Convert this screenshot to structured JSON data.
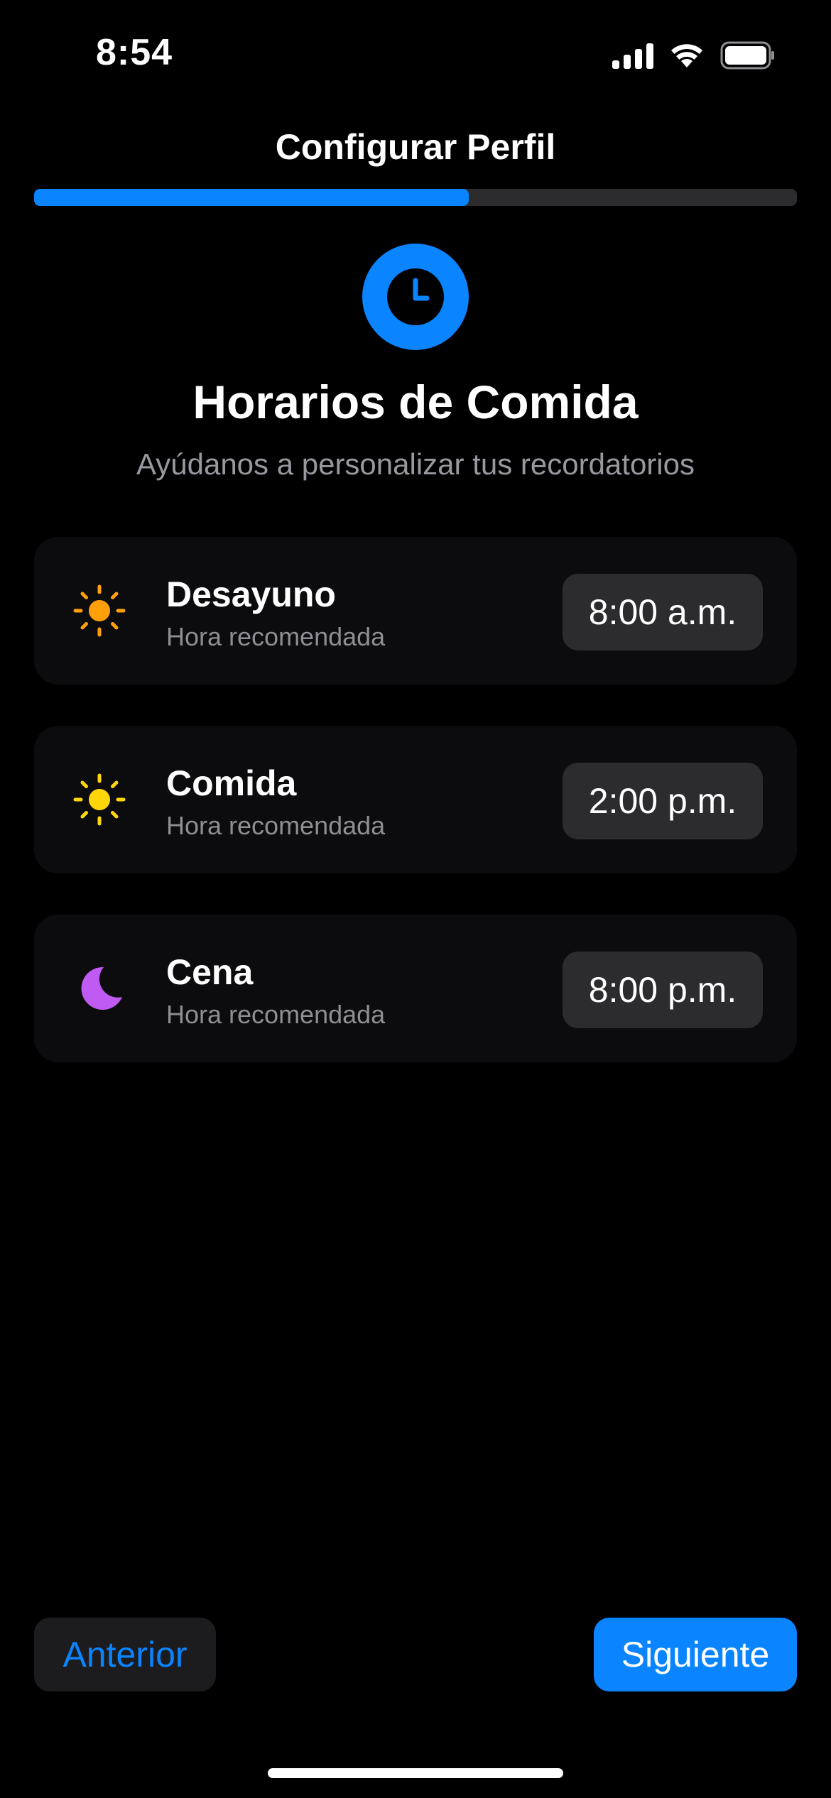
{
  "status_bar": {
    "time": "8:54",
    "signal_icon": "cellular-signal-icon",
    "wifi_icon": "wifi-icon",
    "battery_icon": "battery-full-icon"
  },
  "header": {
    "title": "Configurar Perfil",
    "progress_fraction": 0.57
  },
  "hero": {
    "icon": "clock-icon",
    "title": "Horarios de Comida",
    "subtitle": "Ayúdanos a personalizar tus recordatorios"
  },
  "meals": [
    {
      "name": "Desayuno",
      "hint": "Hora recomendada",
      "time": "8:00 a.m.",
      "icon": "sun-icon",
      "icon_color": "#ff9f0a"
    },
    {
      "name": "Comida",
      "hint": "Hora recomendada",
      "time": "2:00 p.m.",
      "icon": "sun-icon",
      "icon_color": "#ffd60a"
    },
    {
      "name": "Cena",
      "hint": "Hora recomendada",
      "time": "8:00 p.m.",
      "icon": "moon-icon",
      "icon_color": "#bf5af2"
    }
  ],
  "footer": {
    "prev_label": "Anterior",
    "next_label": "Siguiente"
  },
  "colors": {
    "accent": "#0a84ff",
    "background": "#000000",
    "card": "#0c0c0e",
    "pill": "#2c2c2e",
    "secondary_text": "#8e8e93"
  }
}
